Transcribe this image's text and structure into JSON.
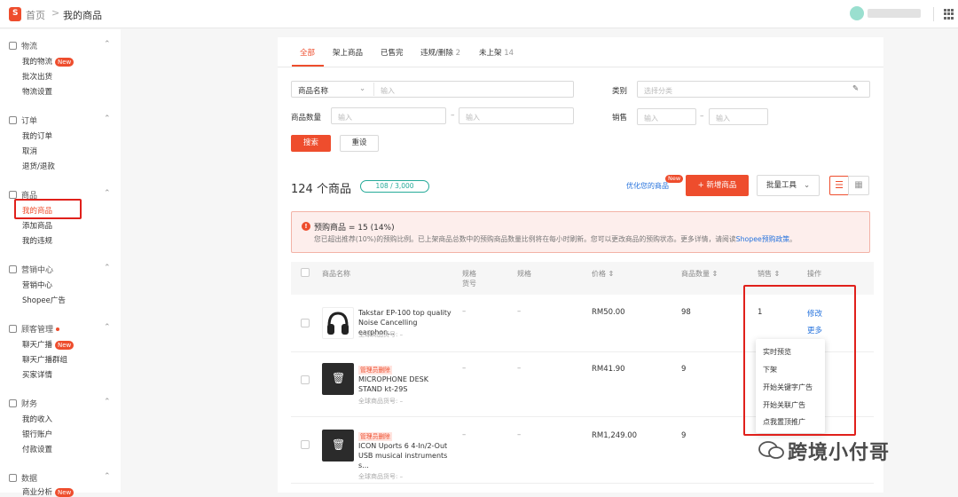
{
  "header": {
    "breadcrumb_home": "首页",
    "breadcrumb_sep": ">",
    "breadcrumb_current": "我的商品"
  },
  "sidebar": {
    "sections": [
      {
        "title": "物流",
        "items": [
          "我的物流",
          "批次出货",
          "物流设置"
        ],
        "badge": "New"
      },
      {
        "title": "订单",
        "items": [
          "我的订单",
          "取消",
          "退货/退款"
        ]
      },
      {
        "title": "商品",
        "items": [
          "我的商品",
          "添加商品",
          "我的违规"
        ]
      },
      {
        "title": "营销中心",
        "items": [
          "营销中心",
          "Shopee广告"
        ]
      },
      {
        "title": "顾客管理",
        "items": [
          "聊天广播",
          "聊天广播群组",
          "买家详情"
        ],
        "badge": "New"
      },
      {
        "title": "财务",
        "items": [
          "我的收入",
          "银行账户",
          "付款设置"
        ]
      },
      {
        "title": "数据",
        "items": [
          "商业分析"
        ],
        "badge": "New"
      }
    ]
  },
  "tabs": [
    {
      "label": "全部",
      "count": ""
    },
    {
      "label": "架上商品",
      "count": ""
    },
    {
      "label": "已售完",
      "count": ""
    },
    {
      "label": "违规/删除",
      "count": "2"
    },
    {
      "label": "未上架",
      "count": "14"
    }
  ],
  "filters": {
    "name_select": "商品名称",
    "name_placeholder": "输入",
    "category_label": "类别",
    "category_placeholder": "选择分类",
    "qty_label": "商品数量",
    "qty_min_placeholder": "输入",
    "qty_max_placeholder": "输入",
    "sales_label": "销售",
    "sales_min_placeholder": "输入",
    "sales_max_placeholder": "输入",
    "dash": "–",
    "search_btn": "搜索",
    "reset_btn": "重设"
  },
  "summary": {
    "count_text": "124 个商品",
    "quota": "108 / 3,000",
    "optimize": "优化您的商品",
    "optimize_badge": "New",
    "add_btn": "新增商品",
    "bulk_btn": "批量工具"
  },
  "alert": {
    "title": "预购商品 = 15 (14%)",
    "body": "您已超出推荐(10%)的预购比例。已上架商品总数中的预购商品数量比例将在每小时刷新。您可以更改商品的预购状态。更多详情，请阅读",
    "link": "Shopee预购政策",
    "tail": "。"
  },
  "table": {
    "headers": [
      "商品名称",
      "规格货号",
      "规格",
      "价格",
      "商品数量",
      "销售",
      "操作"
    ],
    "rows": [
      {
        "name": "Takstar EP-100 top quality Noise Cancelling earphon...",
        "badge": "",
        "sku": "全球商品货号: –",
        "spec_sku": "–",
        "spec": "–",
        "price": "RM50.00",
        "qty": "98",
        "sales": "1",
        "action1": "修改",
        "action2": "更多"
      },
      {
        "name": "MICROPHONE DESK STAND kt-29S",
        "badge": "管理员删除",
        "sku": "全球商品货号: –",
        "spec_sku": "–",
        "spec": "–",
        "price": "RM41.90",
        "qty": "9",
        "sales": "",
        "action1": "",
        "action2": ""
      },
      {
        "name": "ICON Uports 6 4-In/2-Out USB musical instruments s...",
        "badge": "管理员删除",
        "sku": "全球商品货号: –",
        "spec_sku": "–",
        "spec": "–",
        "price": "RM1,249.00",
        "qty": "9",
        "sales": "",
        "action1": "",
        "action2": ""
      }
    ]
  },
  "dropdown": [
    "实时预览",
    "下架",
    "开始关键字广告",
    "开始关联广告",
    "点我置顶推广"
  ],
  "watermark": "跨境小付哥",
  "colors": {
    "brand": "#ee4d2d",
    "link": "#2673dd",
    "quota": "#26aa99",
    "highlight": "#e0201b"
  }
}
